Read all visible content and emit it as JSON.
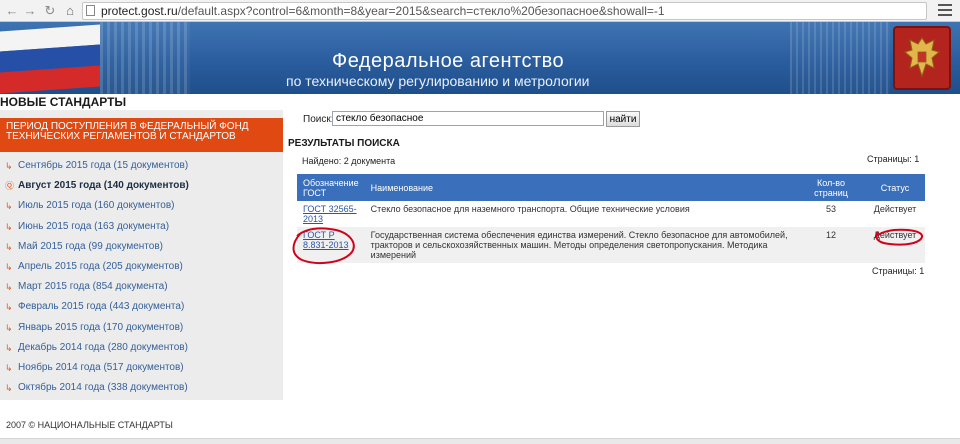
{
  "browser": {
    "url_host": "protect.gost.ru",
    "url_path": "/default.aspx?control=6&month=8&year=2015&search=стекло%20безопасное&showall=-1",
    "back_icon": "arrow-left-icon",
    "forward_icon": "arrow-right-icon",
    "reload_icon": "reload-icon",
    "home_icon": "home-icon",
    "menu_icon": "hamburger-icon"
  },
  "banner": {
    "title": "Федеральное агентство",
    "subtitle": "по техническому регулированию и метрологии"
  },
  "section_heading": "НОВЫЕ СТАНДАРТЫ",
  "sidebar": {
    "header": "ПЕРИОД ПОСТУПЛЕНИЯ В ФЕДЕРАЛЬНЫЙ ФОНД ТЕХНИЧЕСКИХ РЕГЛАМЕНТОВ И СТАНДАРТОВ",
    "items": [
      {
        "label": "Сентябрь 2015 года (15 документов)",
        "active": false
      },
      {
        "label": "Август 2015 года (140 документов)",
        "active": true
      },
      {
        "label": "Июль 2015 года (160 документов)",
        "active": false
      },
      {
        "label": "Июнь 2015 года (163 документа)",
        "active": false
      },
      {
        "label": "Май 2015 года (99 документов)",
        "active": false
      },
      {
        "label": "Апрель 2015 года (205 документов)",
        "active": false
      },
      {
        "label": "Март 2015 года (854 документа)",
        "active": false
      },
      {
        "label": "Февраль 2015 года (443 документа)",
        "active": false
      },
      {
        "label": "Январь 2015 года (170 документов)",
        "active": false
      },
      {
        "label": "Декабрь 2014 года (280 документов)",
        "active": false
      },
      {
        "label": "Ноябрь 2014 года (517 документов)",
        "active": false
      },
      {
        "label": "Октябрь 2014 года (338 документов)",
        "active": false
      }
    ]
  },
  "search": {
    "label": "Поиск:",
    "value": "стекло безопасное",
    "button_label": "найти"
  },
  "results": {
    "heading": "РЕЗУЛЬТАТЫ ПОИСКА",
    "found": "Найдено: 2 документа",
    "pages_top": "Страницы: 1",
    "pages_bottom": "Страницы: 1",
    "columns": {
      "code": "Обозначение ГОСТ",
      "name": "Наименование",
      "pages": "Кол-во страниц",
      "status": "Статус"
    },
    "rows": [
      {
        "code": "ГОСТ 32565-2013",
        "name": "Стекло безопасное для наземного транспорта. Общие технические условия",
        "pages": "53",
        "status": "Действует"
      },
      {
        "code": "ГОСТ Р 8.831-2013",
        "name": "Государственная система обеспечения единства измерений. Стекло безопасное для автомобилей, тракторов и сельскохозяйственных машин. Методы определения светопропускания. Методика измерений",
        "pages": "12",
        "status": "Действует"
      }
    ]
  },
  "footer": "2007 © НАЦИОНАЛЬНЫЕ СТАНДАРТЫ",
  "colors": {
    "banner_blue": "#2a5d9e",
    "sidebar_header_orange": "#e04a12",
    "table_header_blue": "#3a6fbb",
    "annotation_red": "#d0021b"
  }
}
